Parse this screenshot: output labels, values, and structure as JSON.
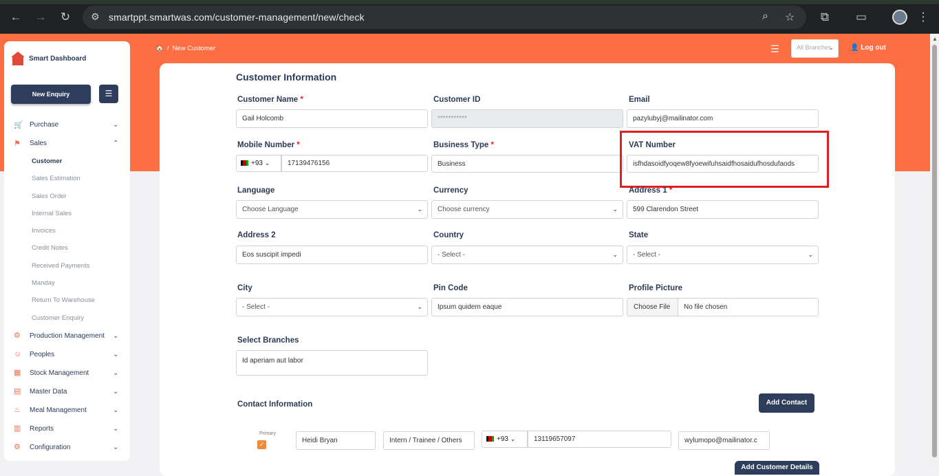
{
  "browser": {
    "url": "smartppt.smartwas.com/customer-management/new/check"
  },
  "sidebar": {
    "app_name": "Smart Dashboard",
    "new_enquiry_label": "New Enquiry",
    "menu_icon": "hamburger-icon",
    "items": [
      {
        "label": "Purchase",
        "icon": "cart-icon",
        "expanded": false
      },
      {
        "label": "Sales",
        "icon": "sales-icon",
        "expanded": true
      }
    ],
    "sales_sub": [
      "Customer",
      "Sales Estimation",
      "Sales Order",
      "Internal Sales",
      "Invoices",
      "Credit Notes",
      "Received Payments",
      "Manday",
      "Return To Warehouse",
      "Customer Enquiry"
    ],
    "active_sub": "Customer",
    "more_items": [
      {
        "label": "Production Management",
        "icon": "factory-icon"
      },
      {
        "label": "Peoples",
        "icon": "people-icon"
      },
      {
        "label": "Stock Management",
        "icon": "stock-icon"
      },
      {
        "label": "Master Data",
        "icon": "data-icon"
      },
      {
        "label": "Meal Management",
        "icon": "meal-icon"
      },
      {
        "label": "Reports",
        "icon": "reports-icon"
      },
      {
        "label": "Configuration",
        "icon": "config-icon"
      }
    ]
  },
  "header": {
    "breadcrumb_current": "New Customer",
    "branch_select": "All Branches",
    "logout_label": "Log out"
  },
  "form": {
    "section_title": "Customer Information",
    "customer_name": {
      "label": "Customer Name",
      "value": "Gail Holcomb"
    },
    "customer_id": {
      "label": "Customer ID",
      "value": "***********"
    },
    "email": {
      "label": "Email",
      "value": "pazylubyj@mailinator.com"
    },
    "mobile": {
      "label": "Mobile Number",
      "code": "+93",
      "value": "17139476156"
    },
    "business_type": {
      "label": "Business Type",
      "value": "Business"
    },
    "vat": {
      "label": "VAT Number",
      "value": "isfhdasoidfyoqew8fyoewifuhsaidfhosaidufhosdufaods"
    },
    "language": {
      "label": "Language",
      "value": "Choose Language"
    },
    "currency": {
      "label": "Currency",
      "value": "Choose currency"
    },
    "address1": {
      "label": "Address 1",
      "value": "599 Clarendon Street"
    },
    "address2": {
      "label": "Address 2",
      "value": "Eos suscipit impedi"
    },
    "country": {
      "label": "Country",
      "value": "- Select -"
    },
    "state": {
      "label": "State",
      "value": "- Select -"
    },
    "city": {
      "label": "City",
      "value": "- Select -"
    },
    "pincode": {
      "label": "Pin Code",
      "value": "Ipsum quidem eaque"
    },
    "profile": {
      "label": "Profile Picture",
      "button": "Choose File",
      "status": "No file chosen"
    },
    "branches": {
      "label": "Select Branches",
      "value": "Id aperiam aut labor"
    }
  },
  "contact": {
    "title": "Contact Information",
    "add_button": "Add Contact",
    "primary_label": "Primary",
    "name": "Heidi Bryan",
    "role": "Intern / Trainee / Others",
    "code": "+93",
    "phone": "13119657097",
    "email": "wylumopo@mailinator.c",
    "add_details_button": "Add Customer Details"
  }
}
